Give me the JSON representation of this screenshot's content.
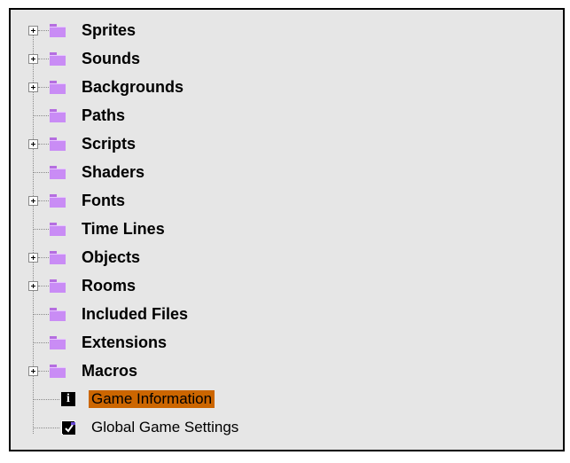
{
  "tree": {
    "items": [
      {
        "label": "Sprites",
        "icon": "folder-icon",
        "expandable": true
      },
      {
        "label": "Sounds",
        "icon": "folder-icon",
        "expandable": true
      },
      {
        "label": "Backgrounds",
        "icon": "folder-icon",
        "expandable": true
      },
      {
        "label": "Paths",
        "icon": "folder-icon",
        "expandable": false
      },
      {
        "label": "Scripts",
        "icon": "folder-icon",
        "expandable": true
      },
      {
        "label": "Shaders",
        "icon": "folder-icon",
        "expandable": false
      },
      {
        "label": "Fonts",
        "icon": "folder-icon",
        "expandable": true
      },
      {
        "label": "Time Lines",
        "icon": "folder-icon",
        "expandable": false
      },
      {
        "label": "Objects",
        "icon": "folder-icon",
        "expandable": true
      },
      {
        "label": "Rooms",
        "icon": "folder-icon",
        "expandable": true
      },
      {
        "label": "Included Files",
        "icon": "folder-icon",
        "expandable": false
      },
      {
        "label": "Extensions",
        "icon": "folder-icon",
        "expandable": false
      },
      {
        "label": "Macros",
        "icon": "folder-icon",
        "expandable": true
      },
      {
        "label": "Game Information",
        "icon": "info-icon",
        "expandable": false,
        "selected": true
      },
      {
        "label": "Global Game Settings",
        "icon": "settings-icon",
        "expandable": false
      }
    ]
  },
  "colors": {
    "panel_bg": "#e6e6e6",
    "folder": "#c98cf5",
    "selection": "#cc6600"
  }
}
